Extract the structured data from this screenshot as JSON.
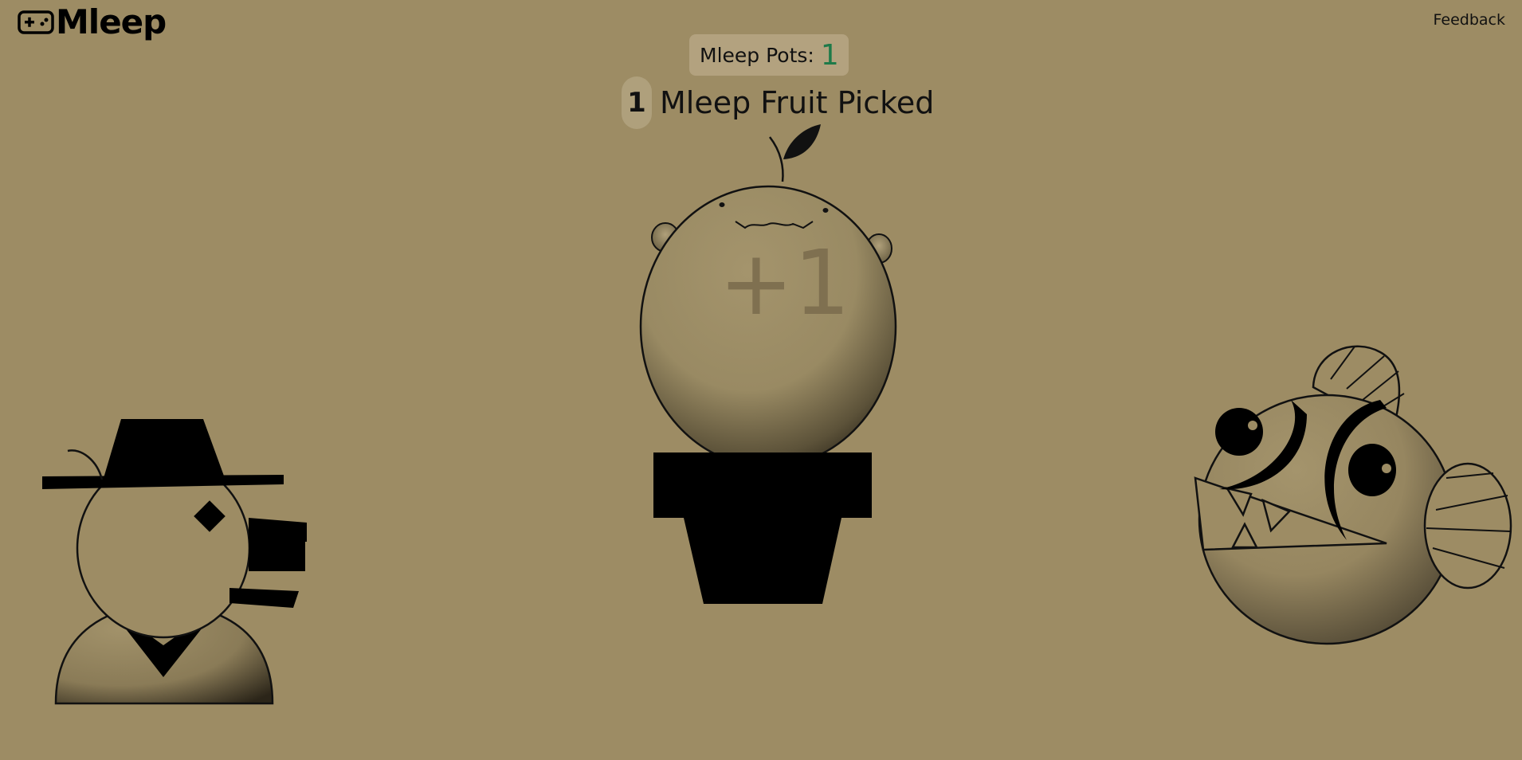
{
  "app": {
    "name": "Mleep",
    "logo_icon": "gamepad-icon"
  },
  "header": {
    "feedback_label": "Feedback"
  },
  "score": {
    "pots_label": "Mleep Pots:",
    "pots_count": "1"
  },
  "fruit": {
    "picked_count": "1",
    "picked_label": "Mleep Fruit Picked",
    "gain_text": "+1"
  },
  "characters": {
    "left": "hat-character-icon",
    "center": "mleep-fruit-plant",
    "right": "fish-character-icon"
  },
  "colors": {
    "background": "#9d8c64",
    "score_accent": "#1e7a49",
    "panel": "#b3a27f"
  }
}
